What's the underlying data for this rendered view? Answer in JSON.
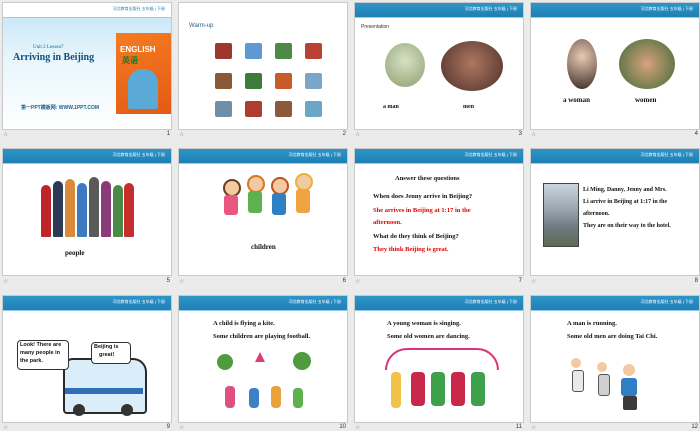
{
  "header_text": "河北教育出版社 五年级 | 下册",
  "slide_numbers": [
    "1",
    "2",
    "3",
    "4",
    "5",
    "6",
    "7",
    "8",
    "9",
    "10",
    "11",
    "12"
  ],
  "slide1": {
    "unit": "Unit 2  Lesson7",
    "title": "Arriving  in  Beijing",
    "site": "第一PPT模板网: WWW.1PPT.COM",
    "book_en": "ENGLISH",
    "book_cn": "英语"
  },
  "slide2": {
    "title": "Warm-up"
  },
  "slide3": {
    "title": "Presentation",
    "label_a": "a man",
    "label_b": "men"
  },
  "slide4": {
    "label_a": "a woman",
    "label_b": "women"
  },
  "slide5": {
    "label": "people"
  },
  "slide6": {
    "label": "children"
  },
  "slide7": {
    "heading": "Answer  these  questions",
    "q1": "When does  Jenny  arrive  in  Beijing?",
    "a1_line1": "She  arrives in Beijing at 1:17 in the",
    "a1_line2": "afternoon.",
    "q2": "What  do  they  think  of  Beijing?",
    "a2": "They  think Beijing is great."
  },
  "slide8": {
    "line1": "Li Ming, Danny, Jenny and Mrs.",
    "line2": "Li arrive in Beijing at 1:17 in the",
    "line3": "afternoon.",
    "line4": "They are on their way to the hotel."
  },
  "slide9": {
    "bubble1_line1": "Look! There are",
    "bubble1_line2": "many people in",
    "bubble1_line3": "the park.",
    "bubble2_line1": "Beijing is",
    "bubble2_line2": "great!"
  },
  "slide10": {
    "line1": "A  child  is flying  a kite.",
    "line2": "Some  children  are  playing  football."
  },
  "slide11": {
    "line1": "A  young woman  is singing.",
    "line2": "Some  old  women  are  dancing."
  },
  "slide12": {
    "line1": "A man is running.",
    "line2": "Some old men are doing Tai Chi."
  }
}
